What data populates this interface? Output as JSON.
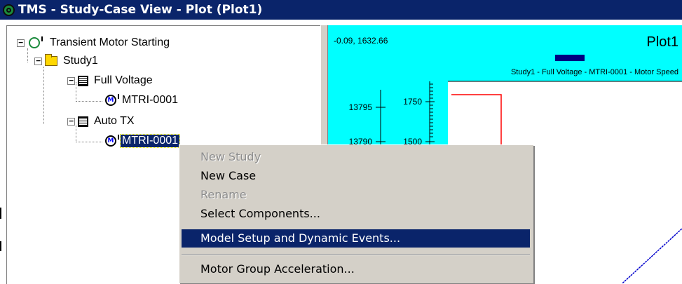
{
  "window": {
    "title": "TMS - Study-Case View - Plot (Plot1)"
  },
  "tree": {
    "root": {
      "label": "Transient Motor Starting",
      "expander": "−"
    },
    "study": {
      "label": "Study1",
      "expander": "−"
    },
    "cases": [
      {
        "label": "Full Voltage",
        "expander": "−",
        "motor": {
          "label": "MTRI-0001",
          "selected": false
        }
      },
      {
        "label": "Auto TX",
        "expander": "−",
        "motor": {
          "label": "MTRI-0001",
          "selected": true
        }
      }
    ]
  },
  "plot": {
    "coords": "-0.09, 1632.66",
    "title": "Plot1",
    "legend_label": "Study1 - Full Voltage - MTRI-0001 - Motor Speed",
    "background": "#00ffff",
    "legend_color": "#000080",
    "axis1_ticks": [
      "13795",
      "13790"
    ],
    "axis2_ticks": [
      "1750",
      "1500"
    ],
    "curve_red": "#ff0000",
    "curve_blue": "#0000cc"
  },
  "context_menu": {
    "items": [
      {
        "label": "New Study",
        "state": "disabled"
      },
      {
        "label": "New Case",
        "state": "enabled"
      },
      {
        "label": "Rename",
        "state": "disabled"
      },
      {
        "label": "Select Components...",
        "state": "enabled"
      },
      {
        "label": "Model Setup and Dynamic Events...",
        "state": "highlighted"
      },
      {
        "label": "Motor Group Acceleration...",
        "state": "enabled"
      }
    ]
  },
  "colors": {
    "titlebar": "#0a246a",
    "selection": "#0a246a",
    "menu_bg": "#d4d0c8"
  }
}
